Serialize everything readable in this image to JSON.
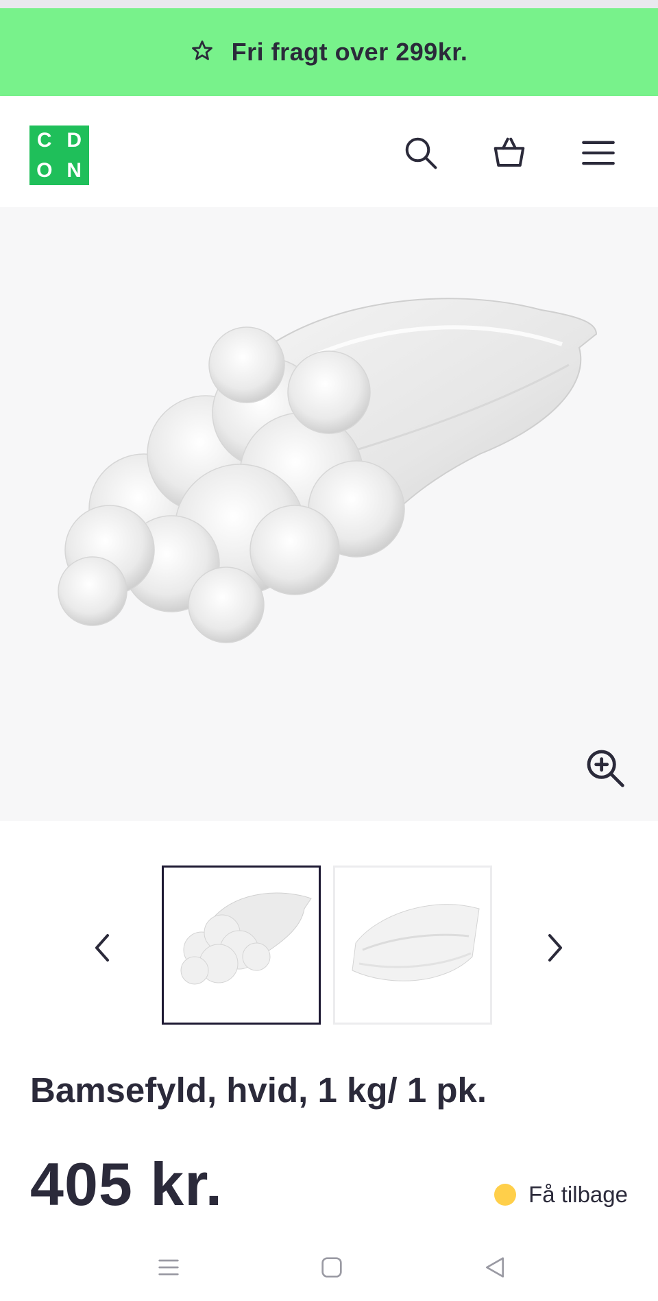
{
  "banner": {
    "text": "Fri fragt over 299kr.",
    "icon": "star-icon",
    "color": "#78f28b"
  },
  "header": {
    "logo_letters": [
      "C",
      "D",
      "O",
      "N"
    ],
    "logo_color": "#1fbf5a",
    "icons": [
      "search-icon",
      "basket-icon",
      "menu-icon"
    ]
  },
  "gallery": {
    "zoom_icon": "zoom-in-icon",
    "prev_icon": "chevron-left-icon",
    "next_icon": "chevron-right-icon"
  },
  "product": {
    "title": "Bamsefyld, hvid, 1 kg/ 1 pk.",
    "price": "405 kr.",
    "cashback_label": "Få tilbage",
    "cashback_dot_color": "#ffcf4a"
  },
  "system_nav": {
    "icons": [
      "recent-apps-icon",
      "home-icon",
      "back-icon"
    ]
  }
}
